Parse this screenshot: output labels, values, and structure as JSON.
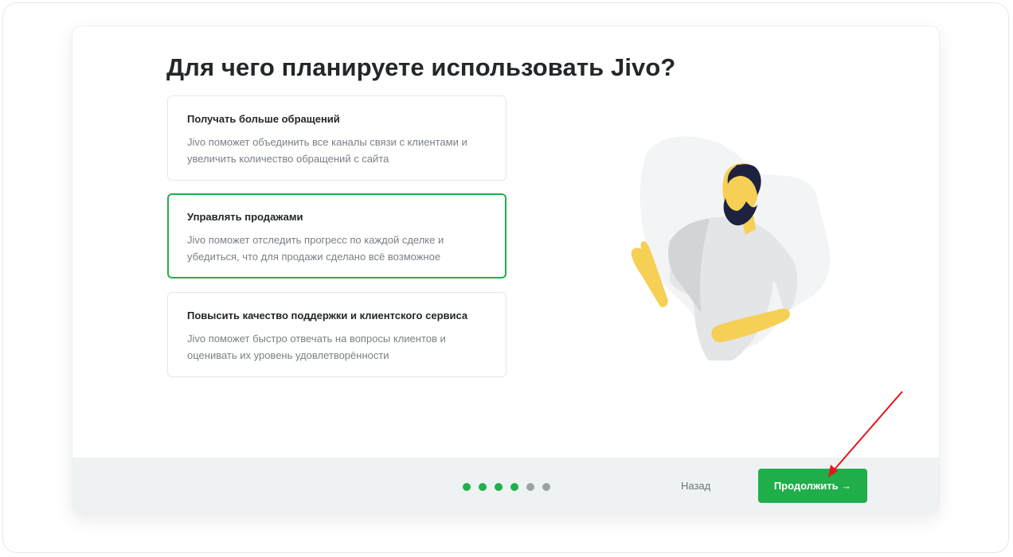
{
  "page": {
    "title": "Для чего планируете использовать Jivo?"
  },
  "options": [
    {
      "title": "Получать больше обращений",
      "description": "Jivo поможет объединить все каналы связи с клиентами и увеличить количество обращений с сайта",
      "selected": false
    },
    {
      "title": "Управлять продажами",
      "description": "Jivo поможет отследить прогресс по каждой сделке и убедиться, что для продажи сделано всё возможное",
      "selected": true
    },
    {
      "title": "Повысить качество поддержки и клиентского сервиса",
      "description": "Jivo поможет быстро отвечать на вопросы клиентов и оценивать их уровень удовлетворённости",
      "selected": false
    }
  ],
  "footer": {
    "progress_steps_total": 6,
    "progress_steps_done": 4,
    "back_label": "Назад",
    "next_label": "Продолжить →"
  },
  "colors": {
    "accent": "#1fae4a",
    "selected_border": "#20b04b",
    "annotation_arrow": "#e8141b"
  }
}
